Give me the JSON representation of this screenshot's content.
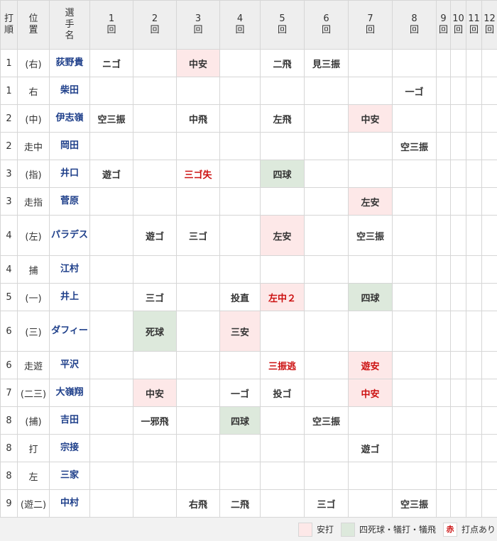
{
  "columns": {
    "batting_order": "打順",
    "position": "位置",
    "player_name": "選手名",
    "innings": [
      "1回",
      "2回",
      "3回",
      "4回",
      "5回",
      "6回",
      "7回",
      "8回",
      "9回",
      "10回",
      "11回",
      "12回"
    ]
  },
  "rows": [
    {
      "order": "1",
      "pos": "(右)",
      "name": "荻野貴",
      "tall": false,
      "cells": [
        {
          "t": "ニゴ"
        },
        {
          "t": ""
        },
        {
          "t": "中安",
          "c": "hit"
        },
        {
          "t": ""
        },
        {
          "t": "二飛"
        },
        {
          "t": "見三振"
        },
        {
          "t": ""
        },
        {
          "t": ""
        },
        {
          "t": ""
        },
        {
          "t": ""
        },
        {
          "t": ""
        },
        {
          "t": ""
        }
      ]
    },
    {
      "order": "1",
      "pos": "右",
      "name": "柴田",
      "tall": false,
      "cells": [
        {
          "t": ""
        },
        {
          "t": ""
        },
        {
          "t": ""
        },
        {
          "t": ""
        },
        {
          "t": ""
        },
        {
          "t": ""
        },
        {
          "t": ""
        },
        {
          "t": "一ゴ"
        },
        {
          "t": ""
        },
        {
          "t": ""
        },
        {
          "t": ""
        },
        {
          "t": ""
        }
      ]
    },
    {
      "order": "2",
      "pos": "(中)",
      "name": "伊志嶺",
      "tall": false,
      "cells": [
        {
          "t": "空三振"
        },
        {
          "t": ""
        },
        {
          "t": "中飛"
        },
        {
          "t": ""
        },
        {
          "t": "左飛"
        },
        {
          "t": ""
        },
        {
          "t": "中安",
          "c": "hit"
        },
        {
          "t": ""
        },
        {
          "t": ""
        },
        {
          "t": ""
        },
        {
          "t": ""
        },
        {
          "t": ""
        }
      ]
    },
    {
      "order": "2",
      "pos": "走中",
      "name": "岡田",
      "tall": false,
      "cells": [
        {
          "t": ""
        },
        {
          "t": ""
        },
        {
          "t": ""
        },
        {
          "t": ""
        },
        {
          "t": ""
        },
        {
          "t": ""
        },
        {
          "t": ""
        },
        {
          "t": "空三振"
        },
        {
          "t": ""
        },
        {
          "t": ""
        },
        {
          "t": ""
        },
        {
          "t": ""
        }
      ]
    },
    {
      "order": "3",
      "pos": "(指)",
      "name": "井口",
      "tall": false,
      "cells": [
        {
          "t": "遊ゴ"
        },
        {
          "t": ""
        },
        {
          "t": "三ゴ失",
          "r": true
        },
        {
          "t": ""
        },
        {
          "t": "四球",
          "c": "walk"
        },
        {
          "t": ""
        },
        {
          "t": ""
        },
        {
          "t": ""
        },
        {
          "t": ""
        },
        {
          "t": ""
        },
        {
          "t": ""
        },
        {
          "t": ""
        }
      ]
    },
    {
      "order": "3",
      "pos": "走指",
      "name": "菅原",
      "tall": false,
      "cells": [
        {
          "t": ""
        },
        {
          "t": ""
        },
        {
          "t": ""
        },
        {
          "t": ""
        },
        {
          "t": ""
        },
        {
          "t": ""
        },
        {
          "t": "左安",
          "c": "hit"
        },
        {
          "t": ""
        },
        {
          "t": ""
        },
        {
          "t": ""
        },
        {
          "t": ""
        },
        {
          "t": ""
        }
      ]
    },
    {
      "order": "4",
      "pos": "(左)",
      "name": "パラデス",
      "tall": true,
      "cells": [
        {
          "t": ""
        },
        {
          "t": "遊ゴ"
        },
        {
          "t": "三ゴ"
        },
        {
          "t": ""
        },
        {
          "t": "左安",
          "c": "hit"
        },
        {
          "t": ""
        },
        {
          "t": "空三振"
        },
        {
          "t": ""
        },
        {
          "t": ""
        },
        {
          "t": ""
        },
        {
          "t": ""
        },
        {
          "t": ""
        }
      ]
    },
    {
      "order": "4",
      "pos": "捕",
      "name": "江村",
      "tall": false,
      "cells": [
        {
          "t": ""
        },
        {
          "t": ""
        },
        {
          "t": ""
        },
        {
          "t": ""
        },
        {
          "t": ""
        },
        {
          "t": ""
        },
        {
          "t": ""
        },
        {
          "t": ""
        },
        {
          "t": ""
        },
        {
          "t": ""
        },
        {
          "t": ""
        },
        {
          "t": ""
        }
      ]
    },
    {
      "order": "5",
      "pos": "(一)",
      "name": "井上",
      "tall": false,
      "cells": [
        {
          "t": ""
        },
        {
          "t": "三ゴ"
        },
        {
          "t": ""
        },
        {
          "t": "投直"
        },
        {
          "t": "左中２",
          "c": "hit",
          "r": true
        },
        {
          "t": ""
        },
        {
          "t": "四球",
          "c": "walk"
        },
        {
          "t": ""
        },
        {
          "t": ""
        },
        {
          "t": ""
        },
        {
          "t": ""
        },
        {
          "t": ""
        }
      ]
    },
    {
      "order": "6",
      "pos": "(三)",
      "name": "ダフィー",
      "tall": true,
      "cells": [
        {
          "t": ""
        },
        {
          "t": "死球",
          "c": "walk"
        },
        {
          "t": ""
        },
        {
          "t": "三安",
          "c": "hit"
        },
        {
          "t": ""
        },
        {
          "t": ""
        },
        {
          "t": ""
        },
        {
          "t": ""
        },
        {
          "t": ""
        },
        {
          "t": ""
        },
        {
          "t": ""
        },
        {
          "t": ""
        }
      ]
    },
    {
      "order": "6",
      "pos": "走遊",
      "name": "平沢",
      "tall": false,
      "cells": [
        {
          "t": ""
        },
        {
          "t": ""
        },
        {
          "t": ""
        },
        {
          "t": ""
        },
        {
          "t": "三振逃",
          "r": true
        },
        {
          "t": ""
        },
        {
          "t": "遊安",
          "c": "hit",
          "r": true
        },
        {
          "t": ""
        },
        {
          "t": ""
        },
        {
          "t": ""
        },
        {
          "t": ""
        },
        {
          "t": ""
        }
      ]
    },
    {
      "order": "7",
      "pos": "(二三)",
      "name": "大嶺翔",
      "tall": false,
      "cells": [
        {
          "t": ""
        },
        {
          "t": "中安",
          "c": "hit"
        },
        {
          "t": ""
        },
        {
          "t": "一ゴ"
        },
        {
          "t": "投ゴ"
        },
        {
          "t": ""
        },
        {
          "t": "中安",
          "c": "hit",
          "r": true
        },
        {
          "t": ""
        },
        {
          "t": ""
        },
        {
          "t": ""
        },
        {
          "t": ""
        },
        {
          "t": ""
        }
      ]
    },
    {
      "order": "8",
      "pos": "(捕)",
      "name": "吉田",
      "tall": false,
      "cells": [
        {
          "t": ""
        },
        {
          "t": "一邪飛"
        },
        {
          "t": ""
        },
        {
          "t": "四球",
          "c": "walk"
        },
        {
          "t": ""
        },
        {
          "t": "空三振"
        },
        {
          "t": ""
        },
        {
          "t": ""
        },
        {
          "t": ""
        },
        {
          "t": ""
        },
        {
          "t": ""
        },
        {
          "t": ""
        }
      ]
    },
    {
      "order": "8",
      "pos": "打",
      "name": "宗接",
      "tall": false,
      "cells": [
        {
          "t": ""
        },
        {
          "t": ""
        },
        {
          "t": ""
        },
        {
          "t": ""
        },
        {
          "t": ""
        },
        {
          "t": ""
        },
        {
          "t": "遊ゴ"
        },
        {
          "t": ""
        },
        {
          "t": ""
        },
        {
          "t": ""
        },
        {
          "t": ""
        },
        {
          "t": ""
        }
      ]
    },
    {
      "order": "8",
      "pos": "左",
      "name": "三家",
      "tall": false,
      "cells": [
        {
          "t": ""
        },
        {
          "t": ""
        },
        {
          "t": ""
        },
        {
          "t": ""
        },
        {
          "t": ""
        },
        {
          "t": ""
        },
        {
          "t": ""
        },
        {
          "t": ""
        },
        {
          "t": ""
        },
        {
          "t": ""
        },
        {
          "t": ""
        },
        {
          "t": ""
        }
      ]
    },
    {
      "order": "9",
      "pos": "(遊二)",
      "name": "中村",
      "tall": false,
      "cells": [
        {
          "t": ""
        },
        {
          "t": ""
        },
        {
          "t": "右飛"
        },
        {
          "t": "二飛"
        },
        {
          "t": ""
        },
        {
          "t": "三ゴ"
        },
        {
          "t": ""
        },
        {
          "t": "空三振"
        },
        {
          "t": ""
        },
        {
          "t": ""
        },
        {
          "t": ""
        },
        {
          "t": ""
        }
      ]
    }
  ],
  "legend": {
    "hit_label": "安打",
    "walk_label": "四死球・犠打・犠飛",
    "rbi_mark": "赤",
    "rbi_label": "打点あり"
  },
  "colors": {
    "hit": "#fde8e8",
    "walk": "#dde9dc",
    "rbi_text": "#cc1111",
    "player_name": "#1e3f8a"
  }
}
